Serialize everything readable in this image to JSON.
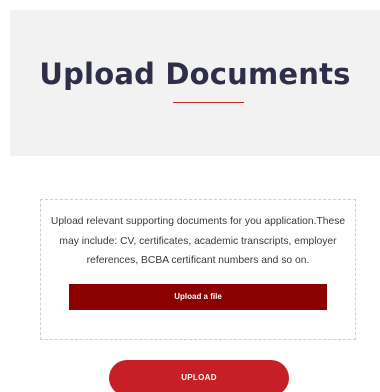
{
  "hero": {
    "title": "Upload Documents",
    "accent_color": "#c62828",
    "title_color": "#2f2e48",
    "background": "#f2f2f2"
  },
  "dropzone": {
    "description": "Upload relevant supporting documents for you application.These may include: CV, certificates, academic transcripts, employer references, BCBA certificant numbers and so on.",
    "upload_file_label": "Upload a file",
    "button_color": "#8b0000"
  },
  "submit": {
    "label": "UPLOAD",
    "color": "#c62026"
  }
}
